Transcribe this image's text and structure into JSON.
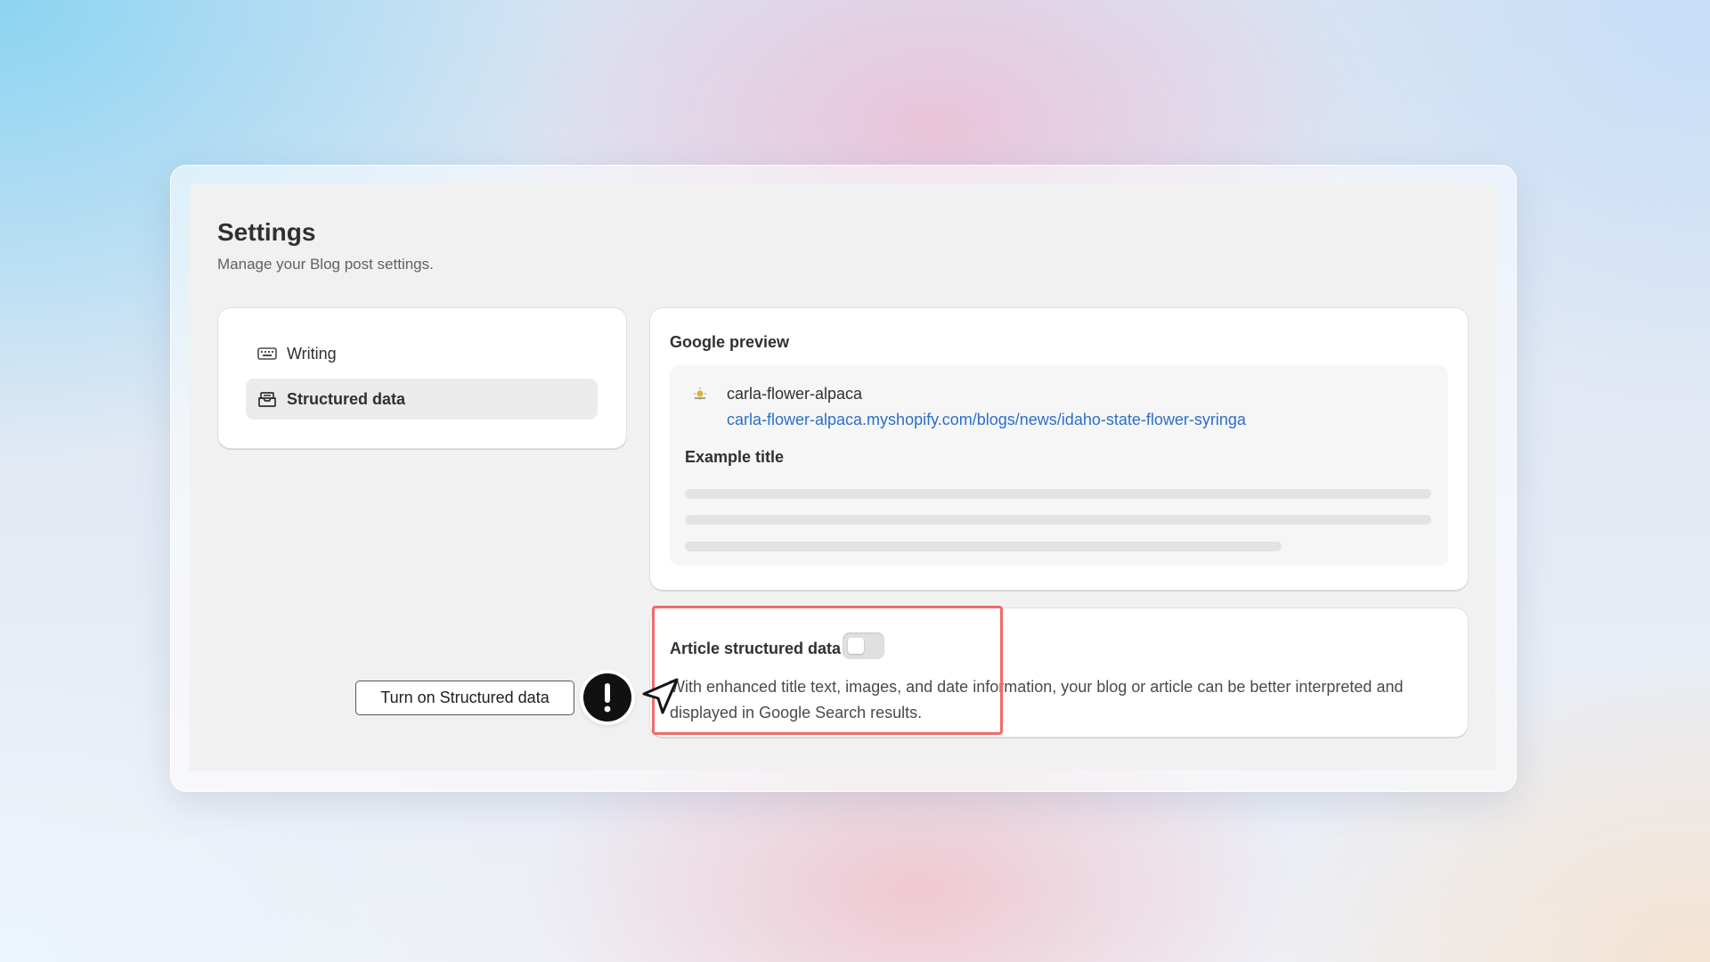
{
  "page": {
    "title": "Settings",
    "subtitle": "Manage your Blog post settings."
  },
  "sidebar": {
    "items": [
      {
        "label": "Writing",
        "icon": "keyboard-icon",
        "selected": false
      },
      {
        "label": "Structured data",
        "icon": "inbox-icon",
        "selected": true
      }
    ]
  },
  "google_preview": {
    "heading": "Google preview",
    "site_name": "carla-flower-alpaca",
    "url": "carla-flower-alpaca.myshopify.com/blogs/news/idaho-state-flower-syringa",
    "example_title": "Example title",
    "favicon": "sun-icon"
  },
  "article_structured_data": {
    "heading": "Article structured data",
    "toggle_on": false,
    "description": "With enhanced title text, images, and date information, your blog or article can be better interpreted and displayed in Google Search results."
  },
  "callout": {
    "label": "Turn on Structured data",
    "badge_icon": "exclamation-icon",
    "pointer_icon": "pointer-arrow-icon"
  },
  "colors": {
    "link": "#2c6ecb",
    "highlight": "#f06b6b",
    "app_background": "#f1f1f1"
  }
}
